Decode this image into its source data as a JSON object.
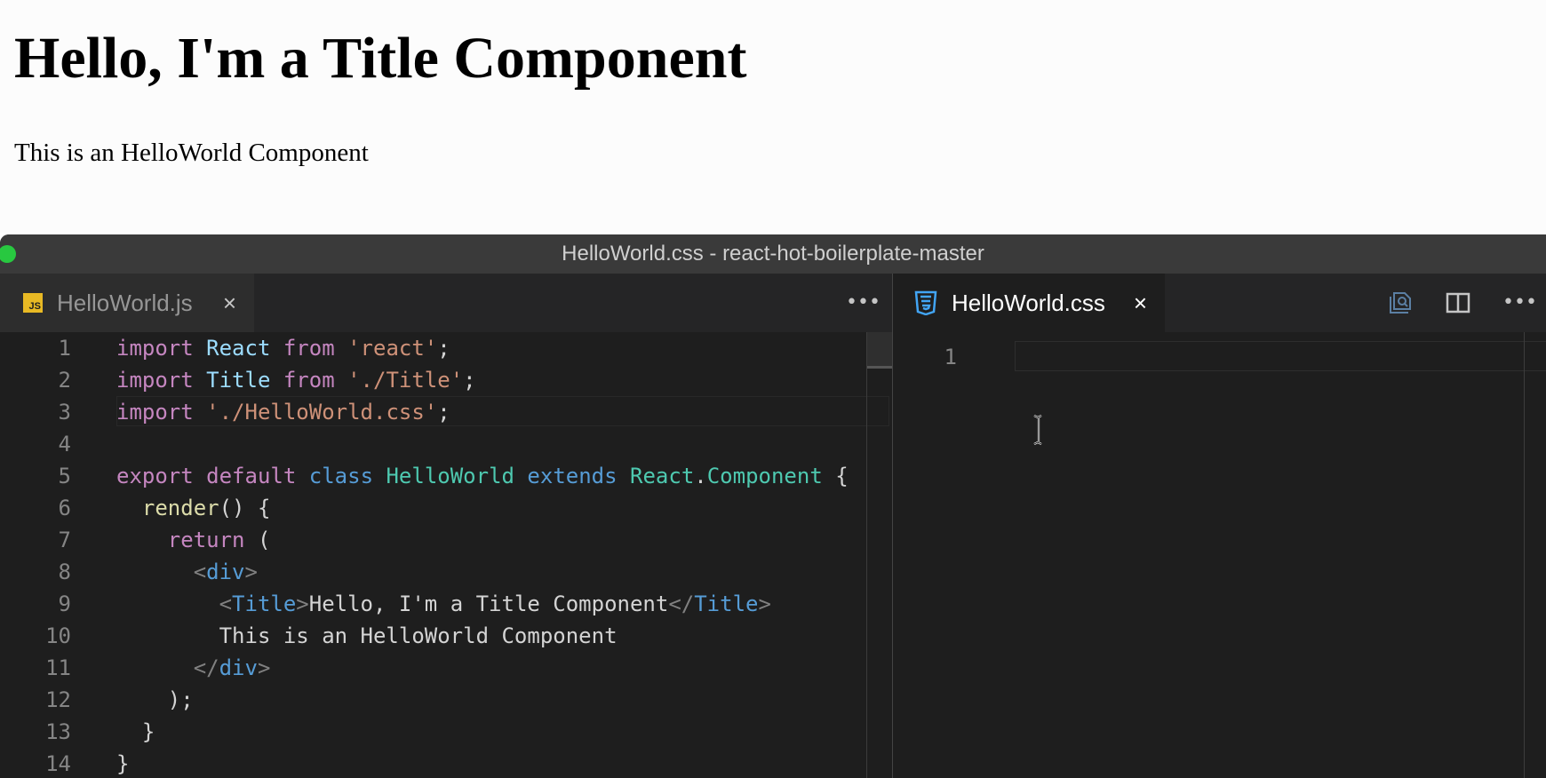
{
  "browser": {
    "heading": "Hello, I'm a Title Component",
    "paragraph": "This is an HelloWorld Component"
  },
  "window": {
    "title": "HelloWorld.css - react-hot-boilerplate-master"
  },
  "left_editor": {
    "tab": {
      "label": "HelloWorld.js",
      "icon": "js-file-icon",
      "icon_text": "JS",
      "close": "×"
    },
    "more": "•••",
    "lines": [
      {
        "n": "1",
        "tokens": [
          [
            "kw",
            "import"
          ],
          [
            "pl",
            " "
          ],
          [
            "var",
            "React"
          ],
          [
            "pl",
            " "
          ],
          [
            "kw",
            "from"
          ],
          [
            "pl",
            " "
          ],
          [
            "str",
            "'react'"
          ],
          [
            "pl",
            ";"
          ]
        ]
      },
      {
        "n": "2",
        "tokens": [
          [
            "kw",
            "import"
          ],
          [
            "pl",
            " "
          ],
          [
            "var",
            "Title"
          ],
          [
            "pl",
            " "
          ],
          [
            "kw",
            "from"
          ],
          [
            "pl",
            " "
          ],
          [
            "str",
            "'./Title'"
          ],
          [
            "pl",
            ";"
          ]
        ]
      },
      {
        "n": "3",
        "tokens": [
          [
            "kw",
            "import"
          ],
          [
            "pl",
            " "
          ],
          [
            "str",
            "'./HelloWorld.css'"
          ],
          [
            "pl",
            ";"
          ]
        ]
      },
      {
        "n": "4",
        "tokens": []
      },
      {
        "n": "5",
        "tokens": [
          [
            "kw",
            "export"
          ],
          [
            "pl",
            " "
          ],
          [
            "kw",
            "default"
          ],
          [
            "pl",
            " "
          ],
          [
            "blue",
            "class"
          ],
          [
            "pl",
            " "
          ],
          [
            "typ",
            "HelloWorld"
          ],
          [
            "pl",
            " "
          ],
          [
            "blue",
            "extends"
          ],
          [
            "pl",
            " "
          ],
          [
            "typ",
            "React"
          ],
          [
            "pl",
            "."
          ],
          [
            "typ",
            "Component"
          ],
          [
            "pl",
            " {"
          ]
        ]
      },
      {
        "n": "6",
        "tokens": [
          [
            "pl",
            "  "
          ],
          [
            "fn",
            "render"
          ],
          [
            "pl",
            "() {"
          ]
        ]
      },
      {
        "n": "7",
        "tokens": [
          [
            "pl",
            "    "
          ],
          [
            "kw",
            "return"
          ],
          [
            "pl",
            " ("
          ]
        ]
      },
      {
        "n": "8",
        "tokens": [
          [
            "pl",
            "      "
          ],
          [
            "br",
            "<"
          ],
          [
            "tag",
            "div"
          ],
          [
            "br",
            ">"
          ]
        ]
      },
      {
        "n": "9",
        "tokens": [
          [
            "pl",
            "        "
          ],
          [
            "br",
            "<"
          ],
          [
            "tag",
            "Title"
          ],
          [
            "br",
            ">"
          ],
          [
            "pl",
            "Hello, I'm a Title Component"
          ],
          [
            "br",
            "</"
          ],
          [
            "tag",
            "Title"
          ],
          [
            "br",
            ">"
          ]
        ]
      },
      {
        "n": "10",
        "tokens": [
          [
            "pl",
            "        This is an HelloWorld Component"
          ]
        ]
      },
      {
        "n": "11",
        "tokens": [
          [
            "pl",
            "      "
          ],
          [
            "br",
            "</"
          ],
          [
            "tag",
            "div"
          ],
          [
            "br",
            ">"
          ]
        ]
      },
      {
        "n": "12",
        "tokens": [
          [
            "pl",
            "    );"
          ]
        ]
      },
      {
        "n": "13",
        "tokens": [
          [
            "pl",
            "  }"
          ]
        ]
      },
      {
        "n": "14",
        "tokens": [
          [
            "pl",
            "}"
          ]
        ]
      }
    ]
  },
  "right_editor": {
    "tab": {
      "label": "HelloWorld.css",
      "icon": "css3-file-icon",
      "close": "×"
    },
    "tools": [
      "open-preview-icon",
      "split-editor-icon"
    ],
    "more": "•••",
    "lines": [
      {
        "n": "1"
      }
    ]
  },
  "colors": {
    "keyword": "#c586c0",
    "variable": "#9cdcfe",
    "string": "#ce9178",
    "type": "#4ec9b0",
    "storage": "#569cd6",
    "function": "#dcdcaa",
    "editor_bg": "#1e1e1e",
    "css_icon": "#42a5f5",
    "js_icon": "#e8b924"
  }
}
